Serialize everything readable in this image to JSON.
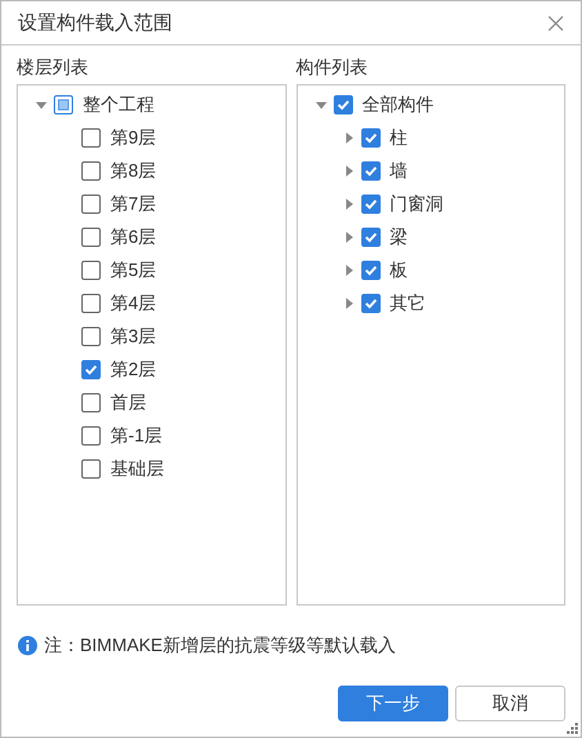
{
  "window": {
    "title": "设置构件载入范围"
  },
  "floor_list": {
    "label": "楼层列表",
    "tree": [
      {
        "label": "整个工程",
        "indeterminate": true,
        "expanded": true,
        "children": [
          {
            "label": "第9层",
            "checked": false
          },
          {
            "label": "第8层",
            "checked": false
          },
          {
            "label": "第7层",
            "checked": false
          },
          {
            "label": "第6层",
            "checked": false
          },
          {
            "label": "第5层",
            "checked": false
          },
          {
            "label": "第4层",
            "checked": false
          },
          {
            "label": "第3层",
            "checked": false
          },
          {
            "label": "第2层",
            "checked": true
          },
          {
            "label": "首层",
            "checked": false
          },
          {
            "label": "第-1层",
            "checked": false
          },
          {
            "label": "基础层",
            "checked": false
          }
        ]
      }
    ]
  },
  "component_list": {
    "label": "构件列表",
    "tree": [
      {
        "label": "全部构件",
        "checked": true,
        "expanded": true,
        "children": [
          {
            "label": "柱",
            "checked": true,
            "expanded": false
          },
          {
            "label": "墙",
            "checked": true,
            "expanded": false
          },
          {
            "label": "门窗洞",
            "checked": true,
            "expanded": false
          },
          {
            "label": "梁",
            "checked": true,
            "expanded": false
          },
          {
            "label": "板",
            "checked": true,
            "expanded": false
          },
          {
            "label": "其它",
            "checked": true,
            "expanded": false
          }
        ]
      }
    ]
  },
  "note": "注：BIMMAKE新增层的抗震等级等默认载入",
  "buttons": [
    {
      "label": "下一步",
      "kind": "primary"
    },
    {
      "label": "取消",
      "kind": "secondary"
    }
  ]
}
